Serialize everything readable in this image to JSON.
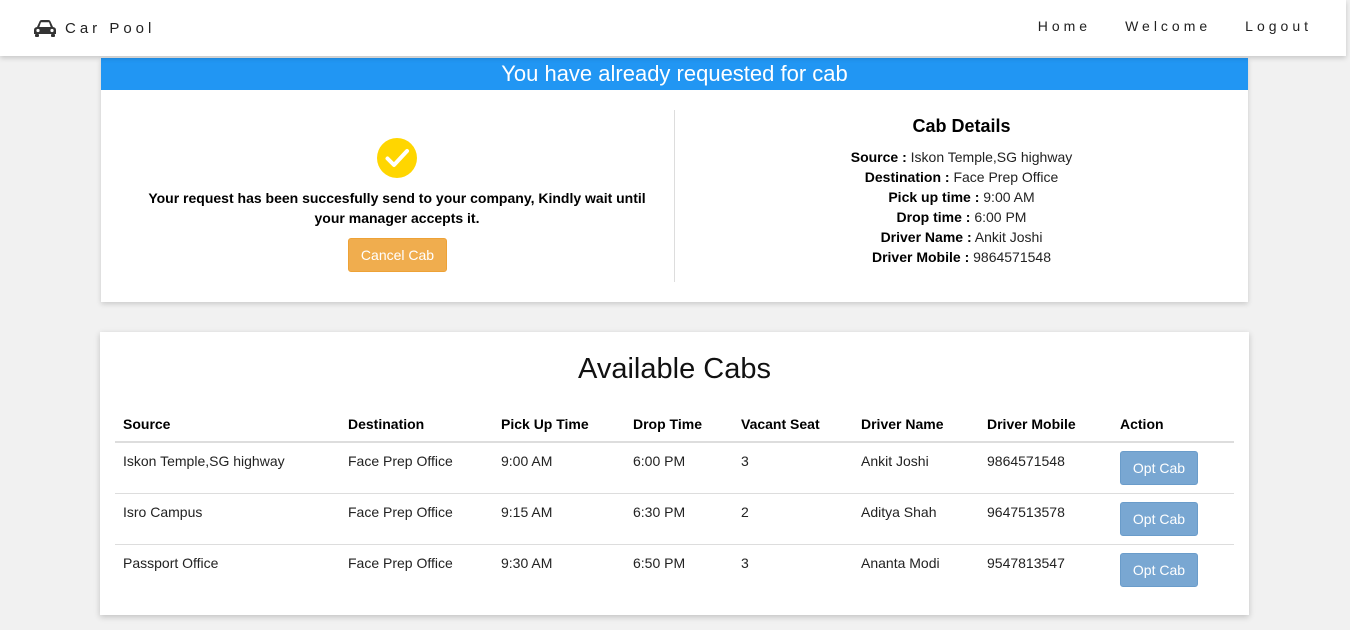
{
  "navbar": {
    "brand_icon": "car-icon",
    "brand_text": "Car Pool",
    "links": [
      "Home",
      "Welcome",
      "Logout"
    ]
  },
  "status": {
    "banner": "You have already requested for cab",
    "icon": "check-circle-icon",
    "icon_color": "#ffd600",
    "message": "Your request has been succesfully send to your company, Kindly wait until your manager accepts it.",
    "cancel_label": "Cancel Cab",
    "banner_color": "#2196f3",
    "cancel_color": "#f0ad4e"
  },
  "cab_details": {
    "title": "Cab Details",
    "rows": [
      {
        "label": "Source :",
        "value": "Iskon Temple,SG highway"
      },
      {
        "label": "Destination :",
        "value": "Face Prep Office"
      },
      {
        "label": "Pick up time :",
        "value": "9:00 AM"
      },
      {
        "label": "Drop time :",
        "value": "6:00 PM"
      },
      {
        "label": "Driver Name :",
        "value": "Ankit Joshi"
      },
      {
        "label": "Driver Mobile :",
        "value": "9864571548"
      }
    ]
  },
  "available_cabs": {
    "title": "Available Cabs",
    "columns": [
      "Source",
      "Destination",
      "Pick Up Time",
      "Drop Time",
      "Vacant Seat",
      "Driver Name",
      "Driver Mobile",
      "Action"
    ],
    "rows": [
      {
        "source": "Iskon Temple,SG highway",
        "destination": "Face Prep Office",
        "pickup": "9:00 AM",
        "drop": "6:00 PM",
        "seats": "3",
        "driver": "Ankit Joshi",
        "mobile": "9864571548",
        "action": "Opt Cab"
      },
      {
        "source": "Isro Campus",
        "destination": "Face Prep Office",
        "pickup": "9:15 AM",
        "drop": "6:30 PM",
        "seats": "2",
        "driver": "Aditya Shah",
        "mobile": "9647513578",
        "action": "Opt Cab"
      },
      {
        "source": "Passport Office",
        "destination": "Face Prep Office",
        "pickup": "9:30 AM",
        "drop": "6:50 PM",
        "seats": "3",
        "driver": "Ananta Modi",
        "mobile": "9547813547",
        "action": "Opt Cab"
      }
    ],
    "action_color": "#79a7d2"
  }
}
